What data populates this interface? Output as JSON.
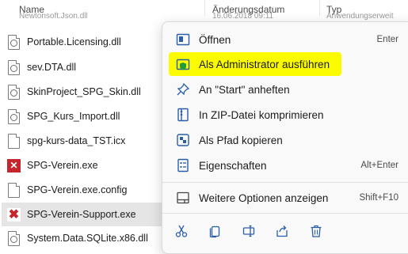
{
  "header": {
    "name": "Name",
    "date": "Änderungsdatum",
    "type": "Typ",
    "ghost_name": "Newtonsoft.Json.dll",
    "ghost_date": "16.06.2018 09:11",
    "ghost_type": "Anwendungserweit"
  },
  "files": [
    {
      "name": "Portable.Licensing.dll",
      "icon": "dll-gear-icon"
    },
    {
      "name": "sev.DTA.dll",
      "icon": "dll-gear-icon"
    },
    {
      "name": "SkinProject_SPG_Skin.dll",
      "icon": "dll-gear-icon"
    },
    {
      "name": "SPG_Kurs_Import.dll",
      "icon": "dll-gear-icon"
    },
    {
      "name": "spg-kurs-data_TST.icx",
      "icon": "document-icon"
    },
    {
      "name": "SPG-Verein.exe",
      "icon": "app-icon"
    },
    {
      "name": "SPG-Verein.exe.config",
      "icon": "document-icon"
    },
    {
      "name": "SPG-Verein-Support.exe",
      "icon": "support-tool-icon"
    },
    {
      "name": "System.Data.SQLite.x86.dll",
      "icon": "dll-gear-icon"
    }
  ],
  "menu": {
    "items": [
      {
        "label": "Öffnen",
        "shortcut": "Enter",
        "icon": "open-window-icon"
      },
      {
        "label": "Als Administrator ausführen",
        "shortcut": "",
        "icon": "shield-icon"
      },
      {
        "label": "An \"Start\" anheften",
        "shortcut": "",
        "icon": "pin-icon"
      },
      {
        "label": "In ZIP-Datei komprimieren",
        "shortcut": "",
        "icon": "zip-folder-icon"
      },
      {
        "label": "Als Pfad kopieren",
        "shortcut": "",
        "icon": "copy-path-icon"
      },
      {
        "label": "Eigenschaften",
        "shortcut": "Alt+Enter",
        "icon": "properties-icon"
      },
      {
        "label": "Weitere Optionen anzeigen",
        "shortcut": "Shift+F10",
        "icon": "more-options-icon"
      }
    ],
    "highlight_color": "#fbfb00",
    "bottom_actions": [
      "cut-icon",
      "copy-icon",
      "rename-icon",
      "share-icon",
      "delete-icon"
    ]
  },
  "colors": {
    "accent": "#0067c0",
    "selection": "#e5e5e5",
    "highlight": "#fbfb00"
  }
}
